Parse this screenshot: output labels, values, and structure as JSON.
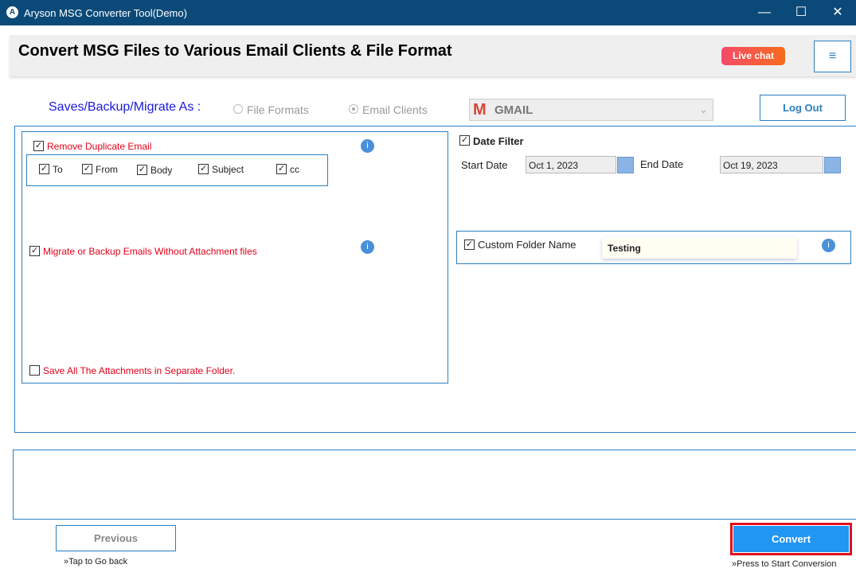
{
  "window": {
    "title": "Aryson MSG Converter Tool(Demo)",
    "minimize": "—",
    "maximize": "☐",
    "close": "✕"
  },
  "header": {
    "title": "Convert MSG Files to Various Email Clients & File Format",
    "live_chat": "Live chat",
    "menu_icon": "≡"
  },
  "save_as": {
    "label": "Saves/Backup/Migrate As :",
    "options": [
      {
        "label": "File Formats",
        "selected": false
      },
      {
        "label": "Email Clients",
        "selected": true
      }
    ],
    "client": "GMAIL",
    "logout": "Log Out"
  },
  "left": {
    "remove_duplicate": {
      "label": "Remove Duplicate Email",
      "checked": true,
      "fields": [
        {
          "label": "To",
          "checked": true
        },
        {
          "label": "From",
          "checked": true
        },
        {
          "label": "Body",
          "checked": true
        },
        {
          "label": "Subject",
          "checked": true
        },
        {
          "label": "cc",
          "checked": true
        }
      ]
    },
    "without_attachments": {
      "label": "Migrate or Backup Emails Without Attachment files",
      "checked": true
    },
    "separate_folder": {
      "label": "Save All The Attachments in Separate Folder.",
      "checked": false
    }
  },
  "right": {
    "date_filter": {
      "label": "Date Filter",
      "checked": true,
      "start_label": "Start Date",
      "start": "Oct 1, 2023",
      "end_label": "End Date",
      "end": "Oct 19, 2023"
    },
    "custom_folder": {
      "label": "Custom Folder Name",
      "checked": true,
      "value": "Testing"
    }
  },
  "footer": {
    "previous": "Previous",
    "previous_hint": "»Tap to Go back",
    "convert": "Convert",
    "convert_hint": "»Press to Start Conversion"
  },
  "colors": {
    "titlebar": "#0b4a78",
    "accent": "#2a7fc1",
    "convert": "#2196f3",
    "warning": "#e0001a"
  }
}
